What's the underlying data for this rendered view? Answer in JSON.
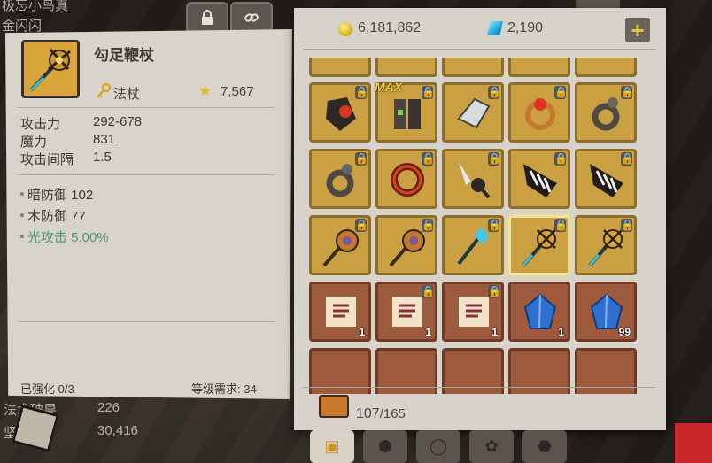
{
  "background": {
    "top_text_1": "极忘小鸟真",
    "top_text_2": "金闪闪",
    "stat_row_1": {
      "name": "法术破果",
      "value": "226"
    },
    "stat_row_2": {
      "name": "坚",
      "value": "30,416"
    }
  },
  "tooltip": {
    "title": "勾足鞭杖",
    "class_label": "法杖",
    "class_icon": "key-icon",
    "power_icon": "star-icon",
    "power": "7,567",
    "stats": [
      {
        "name": "攻击力",
        "value": "292-678"
      },
      {
        "name": "魔力",
        "value": "831"
      },
      {
        "name": "攻击间隔",
        "value": "1.5"
      }
    ],
    "bonuses": [
      {
        "text": "暗防御 102",
        "color": "#3d3833"
      },
      {
        "text": "木防御 77",
        "color": "#3d3833"
      },
      {
        "text": "光攻击 5.00%",
        "color": "#4f9a6a"
      }
    ],
    "enhance": "已强化 0/3",
    "level_req": "等级需求: 34"
  },
  "inventory": {
    "gold": "6,181,862",
    "gems": "2,190",
    "capacity_used": "107",
    "capacity_max": "/165",
    "slots": [
      {
        "kind": "gold",
        "art": "gauntlet-red",
        "lock": true,
        "max": false,
        "count": "",
        "sel": false
      },
      {
        "kind": "gold",
        "art": "boots-dark",
        "lock": true,
        "max": true,
        "count": "",
        "sel": false
      },
      {
        "kind": "gold",
        "art": "bracer-silver",
        "lock": true,
        "max": false,
        "count": "",
        "sel": false
      },
      {
        "kind": "gold",
        "art": "ring-red",
        "lock": true,
        "max": false,
        "count": "",
        "sel": false
      },
      {
        "kind": "gold",
        "art": "ring-gray",
        "lock": true,
        "max": false,
        "count": "",
        "sel": false
      },
      {
        "kind": "gold",
        "art": "ring-gray",
        "lock": true,
        "max": false,
        "count": "",
        "sel": false
      },
      {
        "kind": "gold",
        "art": "ring-red-big",
        "lock": true,
        "max": false,
        "count": "",
        "sel": false
      },
      {
        "kind": "gold",
        "art": "blade-spiked",
        "lock": true,
        "max": false,
        "count": "",
        "sel": false
      },
      {
        "kind": "gold",
        "art": "claw-striped",
        "lock": true,
        "max": false,
        "count": "",
        "sel": false
      },
      {
        "kind": "gold",
        "art": "claw-striped",
        "lock": true,
        "max": false,
        "count": "",
        "sel": false
      },
      {
        "kind": "gold",
        "art": "staff-eye",
        "lock": true,
        "max": false,
        "count": "",
        "sel": false
      },
      {
        "kind": "gold",
        "art": "staff-eye",
        "lock": true,
        "max": false,
        "count": "",
        "sel": false
      },
      {
        "kind": "gold",
        "art": "staff-blue",
        "lock": true,
        "max": false,
        "count": "",
        "sel": false
      },
      {
        "kind": "gold",
        "art": "staff-gold",
        "lock": true,
        "max": false,
        "count": "",
        "sel": true
      },
      {
        "kind": "gold",
        "art": "staff-gold",
        "lock": true,
        "max": false,
        "count": "",
        "sel": false
      },
      {
        "kind": "brown",
        "art": "scroll",
        "lock": false,
        "max": false,
        "count": "1",
        "sel": false
      },
      {
        "kind": "brown",
        "art": "scroll",
        "lock": true,
        "max": false,
        "count": "1",
        "sel": false
      },
      {
        "kind": "brown",
        "art": "scroll",
        "lock": true,
        "max": false,
        "count": "1",
        "sel": false
      },
      {
        "kind": "brown",
        "art": "crystal",
        "lock": false,
        "max": false,
        "count": "1",
        "sel": false
      },
      {
        "kind": "brown",
        "art": "crystal",
        "lock": false,
        "max": false,
        "count": "99",
        "sel": false
      }
    ],
    "tabs": [
      "toolbox-icon",
      "ore-icon",
      "pouch-icon",
      "leaf-icon",
      "gem-icon"
    ]
  }
}
